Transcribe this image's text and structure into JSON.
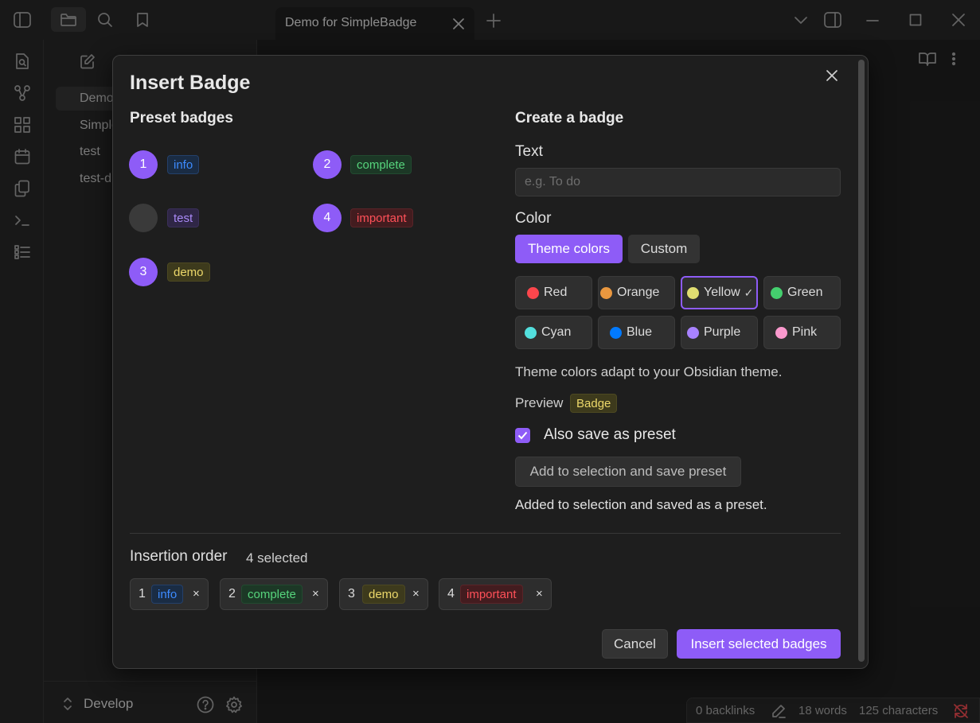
{
  "window": {
    "tab_title": "Demo for SimpleBadge"
  },
  "sidebar": {
    "files": [
      "Demo",
      "Simple",
      "test",
      "test-d"
    ],
    "vault_name": "Develop"
  },
  "statusbar": {
    "backlinks": "0 backlinks",
    "words": "18 words",
    "characters": "125 characters"
  },
  "modal": {
    "title": "Insert Badge",
    "preset_heading": "Preset badges",
    "presets": [
      {
        "order": "1",
        "text": "info",
        "color": "blue"
      },
      {
        "order": "2",
        "text": "complete",
        "color": "green"
      },
      {
        "order": "",
        "text": "test",
        "color": "purple"
      },
      {
        "order": "4",
        "text": "important",
        "color": "red"
      },
      {
        "order": "3",
        "text": "demo",
        "color": "yellow"
      }
    ],
    "create_heading": "Create a badge",
    "text_label": "Text",
    "text_placeholder": "e.g. To do",
    "color_label": "Color",
    "theme_colors_label": "Theme colors",
    "custom_label": "Custom",
    "colors": [
      {
        "name": "Red",
        "hex": "#fb464c"
      },
      {
        "name": "Orange",
        "hex": "#e9973f"
      },
      {
        "name": "Yellow",
        "hex": "#e0de71",
        "selected": true
      },
      {
        "name": "Green",
        "hex": "#44cf6e"
      },
      {
        "name": "Cyan",
        "hex": "#53dfdd"
      },
      {
        "name": "Blue",
        "hex": "#027aff"
      },
      {
        "name": "Purple",
        "hex": "#a882ff"
      },
      {
        "name": "Pink",
        "hex": "#fa99cd"
      }
    ],
    "theme_note": "Theme colors adapt to your Obsidian theme.",
    "preview_label": "Preview",
    "preview_badge": "Badge",
    "save_preset_label": "Also save as preset",
    "save_button": "Add to selection and save preset",
    "status_message": "Added to selection and saved as a preset.",
    "insertion_label": "Insertion order",
    "selected_count": "4 selected",
    "insertion_chips": [
      {
        "order": "1",
        "text": "info",
        "color": "blue"
      },
      {
        "order": "2",
        "text": "complete",
        "color": "green"
      },
      {
        "order": "3",
        "text": "demo",
        "color": "yellow"
      },
      {
        "order": "4",
        "text": "important",
        "color": "red"
      }
    ],
    "remove_glyph": "×",
    "cancel_button": "Cancel",
    "insert_button": "Insert selected badges"
  }
}
